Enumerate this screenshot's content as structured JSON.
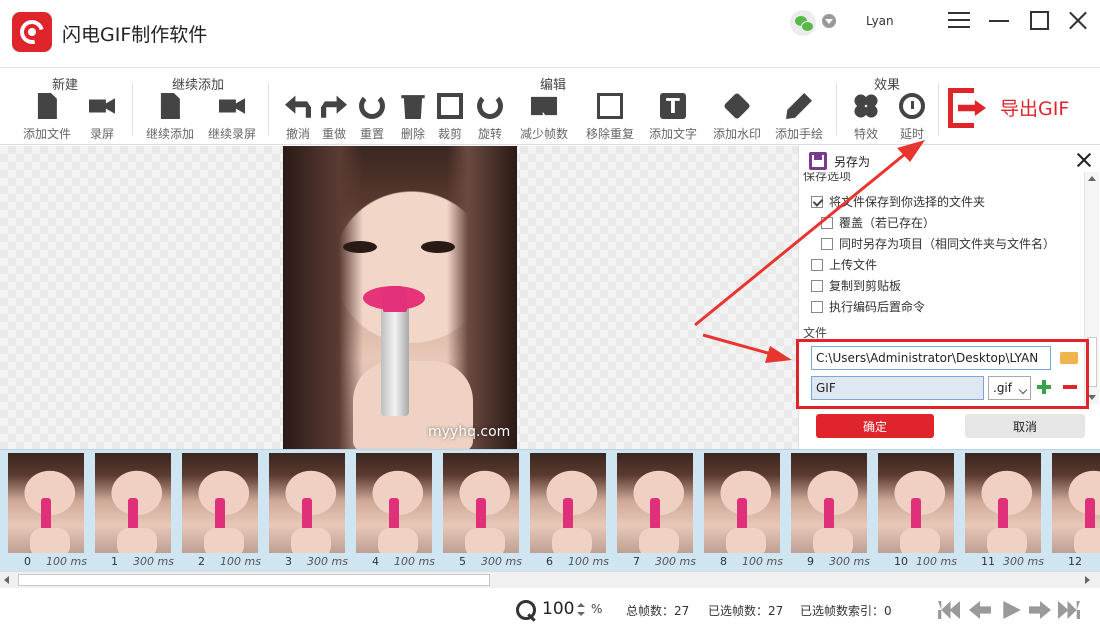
{
  "app": {
    "title": "闪电GIF制作软件",
    "username": "Lyan"
  },
  "toolbar": {
    "groups": {
      "new": "新建",
      "continue": "继续添加",
      "edit": "编辑",
      "effects": "效果"
    },
    "tools": {
      "add_file": "添加文件",
      "record": "录屏",
      "continue_add": "继续添加",
      "continue_record": "继续录屏",
      "undo": "撤消",
      "redo": "重做",
      "reset": "重置",
      "delete": "删除",
      "crop": "裁剪",
      "rotate": "旋转",
      "reduce_frames": "减少帧数",
      "remove_duplicates": "移除重复",
      "add_text": "添加文字",
      "add_watermark": "添加水印",
      "add_drawing": "添加手绘",
      "effects": "特效",
      "delay": "延时"
    },
    "export_label": "导出GIF"
  },
  "canvas": {
    "watermark": "myyhq.com"
  },
  "save_panel": {
    "title": "另存为",
    "options_title": "保存选项",
    "options": [
      {
        "label": "将文件保存到你选择的文件夹",
        "checked": true
      },
      {
        "label": "覆盖（若已存在）",
        "checked": false
      },
      {
        "label": "同时另存为项目（相同文件夹与文件名）",
        "checked": false
      },
      {
        "label": "上传文件",
        "checked": false
      },
      {
        "label": "复制到剪贴板",
        "checked": false
      },
      {
        "label": "执行编码后置命令",
        "checked": false
      }
    ],
    "file_section_title": "文件",
    "path_value": "C:\\Users\\Administrator\\Desktop\\LYAN",
    "name_value": "GIF",
    "extension": ".gif",
    "ok_label": "确定",
    "cancel_label": "取消"
  },
  "filmstrip": {
    "frames": [
      {
        "index": "0",
        "delay": "100 ms"
      },
      {
        "index": "1",
        "delay": "300 ms"
      },
      {
        "index": "2",
        "delay": "100 ms"
      },
      {
        "index": "3",
        "delay": "300 ms"
      },
      {
        "index": "4",
        "delay": "100 ms"
      },
      {
        "index": "5",
        "delay": "300 ms"
      },
      {
        "index": "6",
        "delay": "100 ms"
      },
      {
        "index": "7",
        "delay": "300 ms"
      },
      {
        "index": "8",
        "delay": "100 ms"
      },
      {
        "index": "9",
        "delay": "300 ms"
      },
      {
        "index": "10",
        "delay": "100 ms"
      },
      {
        "index": "11",
        "delay": "300 ms"
      },
      {
        "index": "12",
        "delay": ""
      }
    ]
  },
  "statusbar": {
    "zoom": "100",
    "zoom_unit": "%",
    "total_frames": "总帧数：27",
    "selected_frames": "已选帧数：27",
    "selected_index": "已选帧数索引：0"
  },
  "colors": {
    "accent": "#e0242b",
    "filmstrip_bg": "#cfe5f2"
  }
}
